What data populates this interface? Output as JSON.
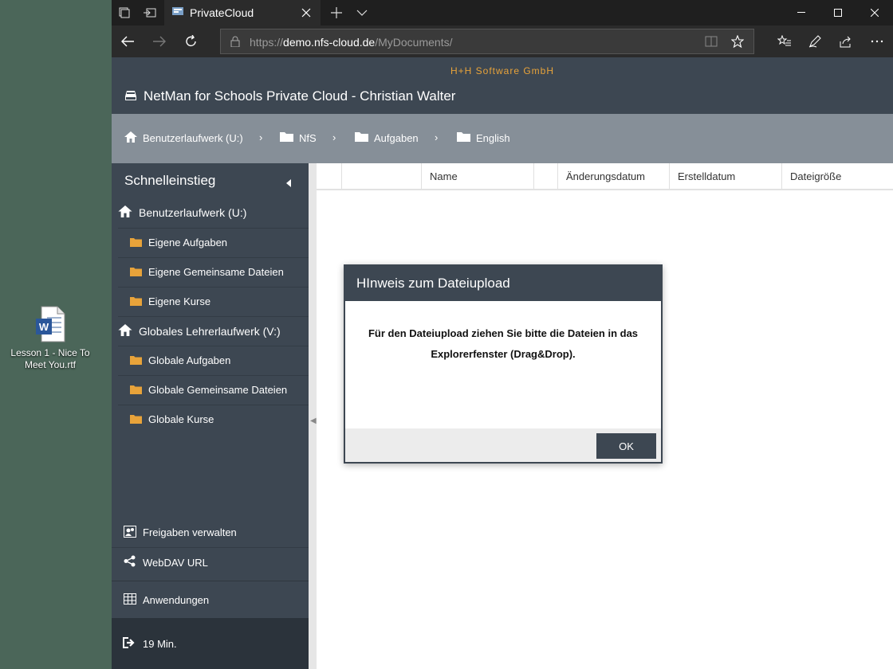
{
  "desktop": {
    "icon_label": "Lesson 1 - Nice To Meet You.rtf"
  },
  "browser": {
    "tab_title": "PrivateCloud",
    "url_prefix": "https://",
    "url_host": "demo.nfs-cloud.de",
    "url_path": "/MyDocuments/"
  },
  "app": {
    "company": "H+H Software GmbH",
    "title": "NetMan for Schools Private Cloud - Christian Walter"
  },
  "breadcrumb": [
    {
      "label": "Benutzerlaufwerk (U:)"
    },
    {
      "label": "NfS"
    },
    {
      "label": "Aufgaben"
    },
    {
      "label": "English"
    }
  ],
  "sidebar": {
    "title": "Schnelleinstieg",
    "user_drive": "Benutzerlaufwerk (U:)",
    "user_items": [
      "Eigene Aufgaben",
      "Eigene Gemeinsame Dateien",
      "Eigene Kurse"
    ],
    "global_drive": "Globales Lehrerlaufwerk (V:)",
    "global_items": [
      "Globale Aufgaben",
      "Globale Gemeinsame Dateien",
      "Globale Kurse"
    ],
    "shares": "Freigaben verwalten",
    "webdav": "WebDAV URL",
    "apps": "Anwendungen",
    "session": "19 Min."
  },
  "table": {
    "columns": [
      "Name",
      "Änderungsdatum",
      "Erstelldatum",
      "Dateigröße"
    ]
  },
  "modal": {
    "title": "HInweis zum Dateiupload",
    "message": "Für den Dateiupload ziehen Sie bitte die Dateien in das Explorerfenster (Drag&Drop).",
    "ok_label": "OK"
  },
  "colors": {
    "header_bg": "#3d4752",
    "breadcrumb_bg": "#868f98",
    "company_accent": "#e8a33a",
    "folder": "#e8a33a"
  }
}
